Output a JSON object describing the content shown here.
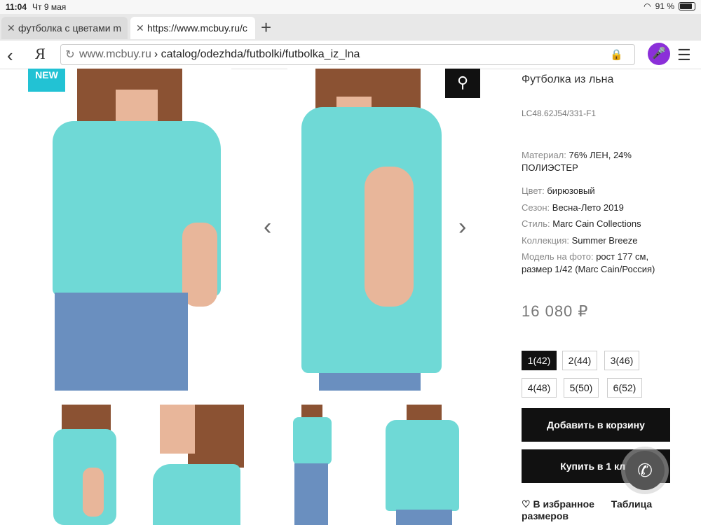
{
  "status": {
    "time": "11:04",
    "date": "Чт 9 мая",
    "battery": "91 %"
  },
  "tabs": [
    {
      "label": "футболка с цветами m"
    },
    {
      "label": "https://www.mcbuy.ru/c"
    }
  ],
  "address": {
    "host": "www.mcbuy.ru",
    "path": "› catalog/odezhda/futbolki/futbolka_iz_lna",
    "ya": "Я"
  },
  "badge": "NEW",
  "product": {
    "title": "Футболка из льна",
    "sku": "LC48.62J54/331-F1",
    "material_key": "Материал: ",
    "material_val": "76% ЛЕН, 24% ПОЛИЭСТЕР",
    "color_key": "Цвет: ",
    "color_val": "бирюзовый",
    "season_key": "Сезон: ",
    "season_val": "Весна-Лето 2019",
    "style_key": "Стиль: ",
    "style_val": "Marc Cain Collections",
    "collection_key": "Коллекция: ",
    "collection_val": "Summer Breeze",
    "model_key": "Модель на фото: ",
    "model_val": "рост 177 см, размер 1/42 (Marc Cain/Россия)",
    "price": "16 080 ₽"
  },
  "sizes": [
    "1(42)",
    "2(44)",
    "3(46)",
    "4(48)",
    "5(50)",
    "6(52)"
  ],
  "selected_size": "1(42)",
  "buttons": {
    "add_to_cart": "Добавить в корзину",
    "buy_one_click": "Купить в 1 кли"
  },
  "favorites": "В избранное",
  "size_table": "Таблица размеров",
  "colors": {
    "accent": "#22c2d4",
    "mic": "#8b2fd9",
    "shirt": "#6fd9d6"
  }
}
